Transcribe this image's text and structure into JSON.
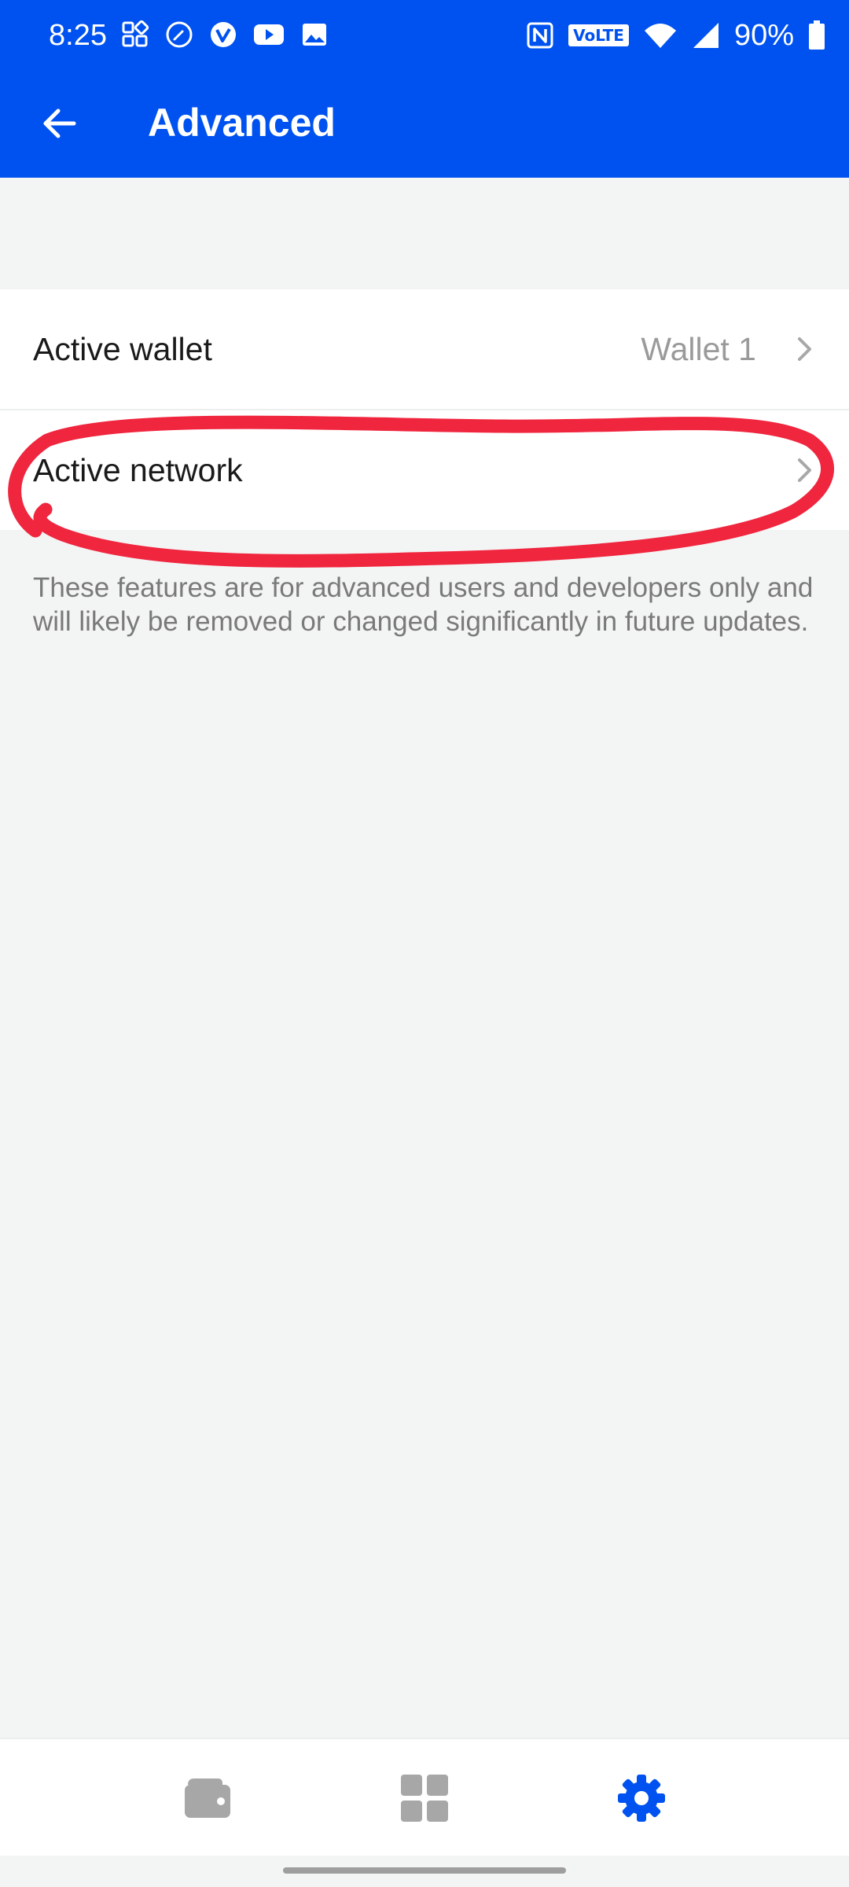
{
  "status_bar": {
    "time": "8:25",
    "battery_percent": "90%",
    "volte_label": "VoLTE",
    "left_icons": [
      "grid-apps-icon",
      "compass-icon",
      "vimeo-icon",
      "youtube-icon",
      "image-icon"
    ],
    "right_icons": [
      "nfc-icon",
      "volte-icon",
      "wifi-icon",
      "signal-icon",
      "battery-icon"
    ]
  },
  "app_bar": {
    "title": "Advanced",
    "back_icon": "arrow-back-icon",
    "background_color": "#0052F0"
  },
  "settings": {
    "rows": [
      {
        "label": "Active wallet",
        "value": "Wallet 1",
        "icon": "chevron-right-icon"
      },
      {
        "label": "Active network",
        "value": "",
        "icon": "chevron-right-icon"
      }
    ],
    "helper_text": "These features are for advanced users and developers only and will likely be removed or changed significantly in future updates."
  },
  "annotation": {
    "type": "red-circle",
    "target": "Active network",
    "color": "#F0253E"
  },
  "bottom_nav": {
    "items": [
      {
        "icon": "wallet-icon",
        "active": false
      },
      {
        "icon": "dashboard-icon",
        "active": false
      },
      {
        "icon": "settings-gear-icon",
        "active": true
      }
    ],
    "active_color": "#0052F0",
    "inactive_color": "#A7A7A7"
  }
}
